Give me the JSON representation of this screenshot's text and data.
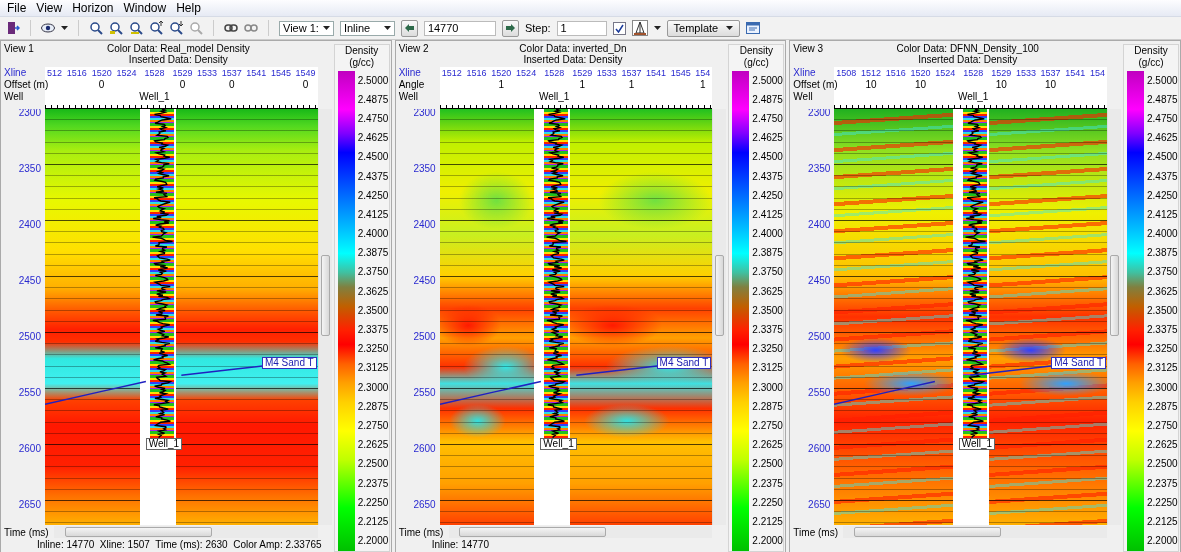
{
  "menu": [
    "File",
    "View",
    "Horizon",
    "Window",
    "Help"
  ],
  "toolbar": {
    "view_select": "View 1:",
    "slice_select": "Inline",
    "inline_value": "14770",
    "step_label": "Step:",
    "step_value": "1",
    "checkbox": {
      "checked": true
    },
    "template_button": "Template"
  },
  "views": [
    {
      "title": "View 1",
      "color_data": "Color Data: Real_model Density",
      "inserted_data": "Inserted Data: Density",
      "xline_label": "Xline",
      "row2_label": "Offset (m)",
      "well_row_label": "Well",
      "well_name": "Well_1",
      "xlines_left": [
        {
          "label": "512"
        },
        {
          "label": "1516"
        },
        {
          "label": "1520",
          "row2": "0"
        },
        {
          "label": "1524"
        }
      ],
      "xline_well": "1528",
      "xlines_right": [
        {
          "label": "1529",
          "row2": "0"
        },
        {
          "label": "1533"
        },
        {
          "label": "1537",
          "row2": "0"
        },
        {
          "label": "1541"
        },
        {
          "label": "1545"
        },
        {
          "label": "1549",
          "row2": "0"
        }
      ],
      "time_labels": [
        "2300",
        "2350",
        "2400",
        "2450",
        "2500",
        "2550",
        "2600",
        "2650"
      ],
      "horizon_label": "M4 Sand T",
      "well_marker": "Well_1",
      "axis_label": "Time (ms)",
      "status": "Inline: 14770  Xline: 1507  Time (ms): 2630  Color Amp: 2.33765",
      "colorbar": {
        "title": "Density",
        "unit": "(g/cc)",
        "labels": [
          "2.5000",
          "2.4875",
          "2.4750",
          "2.4625",
          "2.4500",
          "2.4375",
          "2.4250",
          "2.4125",
          "2.4000",
          "2.3875",
          "2.3750",
          "2.3625",
          "2.3500",
          "2.3375",
          "2.3250",
          "2.3125",
          "2.3000",
          "2.2875",
          "2.2750",
          "2.2625",
          "2.2500",
          "2.2375",
          "2.2250",
          "2.2125",
          "2.2000"
        ]
      }
    },
    {
      "title": "View 2",
      "color_data": "Color Data: inverted_Dn",
      "inserted_data": "Inserted Data: Density",
      "xline_label": "Xline",
      "row2_label": "Angle",
      "well_row_label": "Well",
      "well_name": "Well_1",
      "xlines_left": [
        {
          "label": "1512"
        },
        {
          "label": "1516"
        },
        {
          "label": "1520",
          "row2": "1"
        },
        {
          "label": "1524"
        }
      ],
      "xline_well": "1528",
      "xlines_right": [
        {
          "label": "1529",
          "row2": "1"
        },
        {
          "label": "1533"
        },
        {
          "label": "1537",
          "row2": "1"
        },
        {
          "label": "1541"
        },
        {
          "label": "1545"
        },
        {
          "label": "154",
          "row2": "1"
        }
      ],
      "time_labels": [
        "2300",
        "2350",
        "2400",
        "2450",
        "2500",
        "2550",
        "2600",
        "2650"
      ],
      "horizon_label": "M4 Sand T",
      "well_marker": "Well_1",
      "axis_label": "Time (ms)",
      "status": "Inline: 14770",
      "colorbar": {
        "title": "Density",
        "unit": "(g/cc)",
        "labels": [
          "2.5000",
          "2.4875",
          "2.4750",
          "2.4625",
          "2.4500",
          "2.4375",
          "2.4250",
          "2.4125",
          "2.4000",
          "2.3875",
          "2.3750",
          "2.3625",
          "2.3500",
          "2.3375",
          "2.3250",
          "2.3125",
          "2.3000",
          "2.2875",
          "2.2750",
          "2.2625",
          "2.2500",
          "2.2375",
          "2.2250",
          "2.2125",
          "2.2000"
        ]
      }
    },
    {
      "title": "View 3",
      "color_data": "Color Data: DFNN_Density_100",
      "inserted_data": "Inserted Data: Density",
      "xline_label": "Xline",
      "row2_label": "Offset (m)",
      "well_row_label": "Well",
      "well_name": "Well_1",
      "xlines_left": [
        {
          "label": "1508"
        },
        {
          "label": "1512",
          "row2": "10"
        },
        {
          "label": "1516"
        },
        {
          "label": "1520",
          "row2": "10"
        },
        {
          "label": "1524"
        }
      ],
      "xline_well": "1528",
      "xlines_right": [
        {
          "label": "1529",
          "row2": "10"
        },
        {
          "label": "1533"
        },
        {
          "label": "1537",
          "row2": "10"
        },
        {
          "label": "1541"
        },
        {
          "label": "154"
        }
      ],
      "time_labels": [
        "2300",
        "2350",
        "2400",
        "2450",
        "2500",
        "2550",
        "2600",
        "2650"
      ],
      "horizon_label": "M4 Sand T",
      "well_marker": "Well_1",
      "axis_label": "Time (ms)",
      "colorbar": {
        "title": "Density",
        "unit": "(g/cc)",
        "labels": [
          "2.5000",
          "2.4875",
          "2.4750",
          "2.4625",
          "2.4500",
          "2.4375",
          "2.4250",
          "2.4125",
          "2.4000",
          "2.3875",
          "2.3750",
          "2.3625",
          "2.3500",
          "2.3375",
          "2.3250",
          "2.3125",
          "2.3000",
          "2.2875",
          "2.2750",
          "2.2625",
          "2.2500",
          "2.2375",
          "2.2250",
          "2.2125",
          "2.2000"
        ]
      }
    }
  ]
}
